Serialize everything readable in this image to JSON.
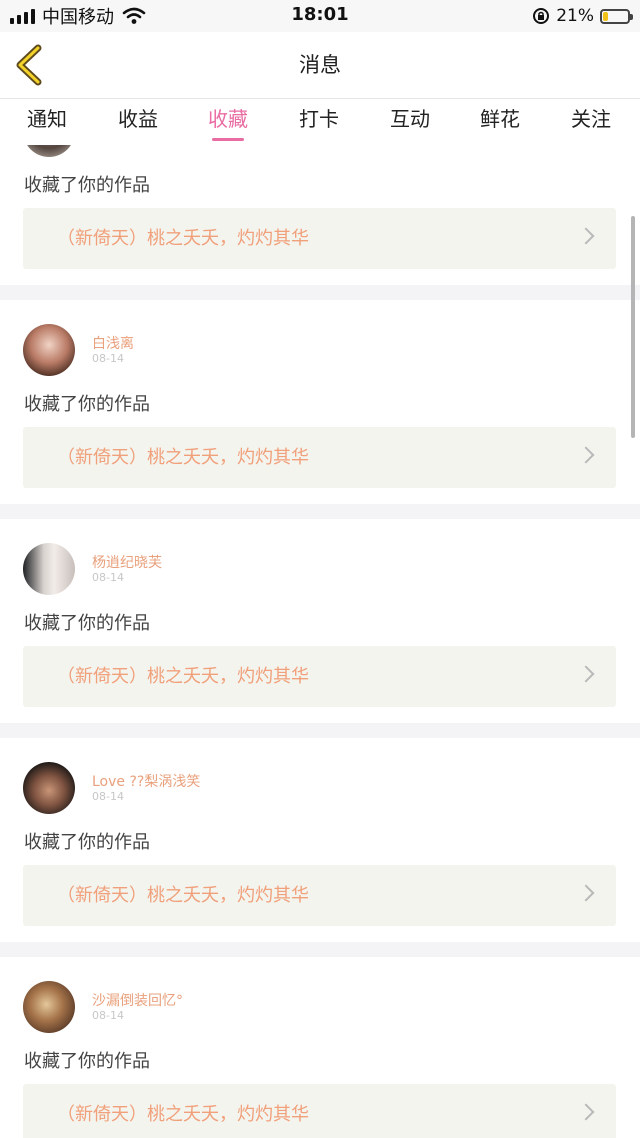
{
  "status_bar": {
    "carrier": "中国移动",
    "time": "18:01",
    "battery_percent": "21%",
    "battery_level": 0.21,
    "icons": [
      "signal-icon",
      "wifi-icon",
      "orientation-lock-icon",
      "battery-charging-icon"
    ]
  },
  "nav": {
    "title": "消息",
    "back_icon": "chevron-left-icon"
  },
  "tabs": [
    {
      "label": "通知"
    },
    {
      "label": "收益"
    },
    {
      "label": "收藏",
      "active": true
    },
    {
      "label": "打卡"
    },
    {
      "label": "互动"
    },
    {
      "label": "鲜花"
    },
    {
      "label": "关注"
    }
  ],
  "accent_color": "#e96ca3",
  "name_color": "#e9a07c",
  "feed": [
    {
      "name": "",
      "date": "",
      "action": "收藏了你的作品",
      "work": "（新倚天）桃之夭夭，灼灼其华"
    },
    {
      "name": "白浅离",
      "date": "08-14",
      "action": "收藏了你的作品",
      "work": "（新倚天）桃之夭夭，灼灼其华"
    },
    {
      "name": "杨逍纪晓芙",
      "date": "08-14",
      "action": "收藏了你的作品",
      "work": "（新倚天）桃之夭夭，灼灼其华"
    },
    {
      "name": "Love ??梨涡浅笑",
      "date": "08-14",
      "action": "收藏了你的作品",
      "work": "（新倚天）桃之夭夭，灼灼其华"
    },
    {
      "name": "沙漏倒装回忆°",
      "date": "08-14",
      "action": "收藏了你的作品",
      "work": "（新倚天）桃之夭夭，灼灼其华"
    }
  ]
}
